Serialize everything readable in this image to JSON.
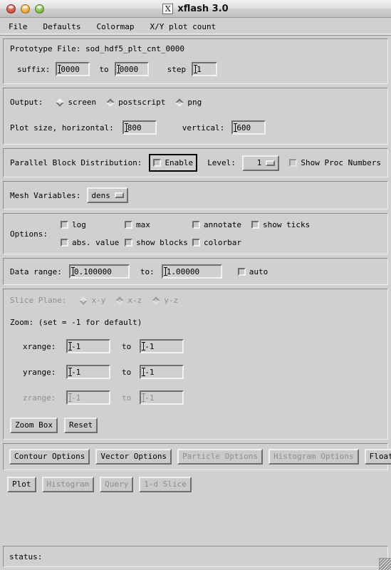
{
  "window": {
    "title": "xflash 3.0",
    "app_icon": "x11-icon",
    "traffic_lights": [
      "close-red",
      "minimize-yellow",
      "zoom-green"
    ]
  },
  "menubar": {
    "items": [
      {
        "label": "File"
      },
      {
        "label": "Defaults"
      },
      {
        "label": "Colormap"
      },
      {
        "label": "X/Y plot count"
      }
    ]
  },
  "prototype": {
    "file_label": "Prototype File: sod_hdf5_plt_cnt_0000",
    "suffix_label": "suffix:",
    "suffix_value": "0000",
    "to_label": "to",
    "to_value": "0000",
    "step_label": "step",
    "step_value": "1"
  },
  "output": {
    "label": "Output:",
    "options": [
      {
        "label": "screen",
        "selected": true
      },
      {
        "label": "postscript",
        "selected": false
      },
      {
        "label": "png",
        "selected": false
      }
    ],
    "plot_size_label": "Plot size, horizontal:",
    "horizontal_value": "800",
    "vertical_label": "vertical:",
    "vertical_value": "600"
  },
  "parallel": {
    "label": "Parallel Block Distribution:",
    "enable_label": "Enable",
    "enable_checked": false,
    "level_label": "Level:",
    "level_value": "1",
    "show_proc_label": "Show Proc Numbers",
    "show_proc_checked": false
  },
  "mesh": {
    "label": "Mesh Variables:",
    "value": "dens"
  },
  "options": {
    "label": "Options:",
    "row1": [
      {
        "label": "log",
        "checked": false
      },
      {
        "label": "max",
        "checked": false
      },
      {
        "label": "annotate",
        "checked": false
      },
      {
        "label": "show ticks",
        "checked": false
      }
    ],
    "row2": [
      {
        "label": "abs. value",
        "checked": false
      },
      {
        "label": "show blocks",
        "checked": false
      },
      {
        "label": "colorbar",
        "checked": false
      }
    ]
  },
  "data_range": {
    "label": "Data range:",
    "from_value": "0.100000",
    "to_label": "to:",
    "to_value": "1.00000",
    "auto_label": "auto",
    "auto_checked": false
  },
  "slice": {
    "label": "Slice Plane:",
    "options": [
      {
        "label": "x-y",
        "selected": true
      },
      {
        "label": "x-z",
        "selected": false
      },
      {
        "label": "y-z",
        "selected": false
      }
    ],
    "zoom_hint": "Zoom: (set = -1 for default)",
    "ranges": [
      {
        "label": "xrange:",
        "from": "-1",
        "to_label": "to",
        "to": "-1",
        "enabled": true
      },
      {
        "label": "yrange:",
        "from": "-1",
        "to_label": "to",
        "to": "-1",
        "enabled": true
      },
      {
        "label": "zrange:",
        "from": "-1",
        "to_label": "to",
        "to": "-1",
        "enabled": false
      }
    ],
    "zoom_box_label": "Zoom Box",
    "reset_label": "Reset"
  },
  "option_buttons": [
    {
      "label": "Contour Options",
      "enabled": true
    },
    {
      "label": "Vector Options",
      "enabled": true
    },
    {
      "label": "Particle Options",
      "enabled": false
    },
    {
      "label": "Histogram Options",
      "enabled": false
    },
    {
      "label": "Floating Label",
      "enabled": true
    }
  ],
  "action_buttons": [
    {
      "label": "Plot",
      "enabled": true
    },
    {
      "label": "Histogram",
      "enabled": false
    },
    {
      "label": "Query",
      "enabled": false
    },
    {
      "label": "1-d Slice",
      "enabled": false
    }
  ],
  "status": {
    "text": "status:"
  }
}
